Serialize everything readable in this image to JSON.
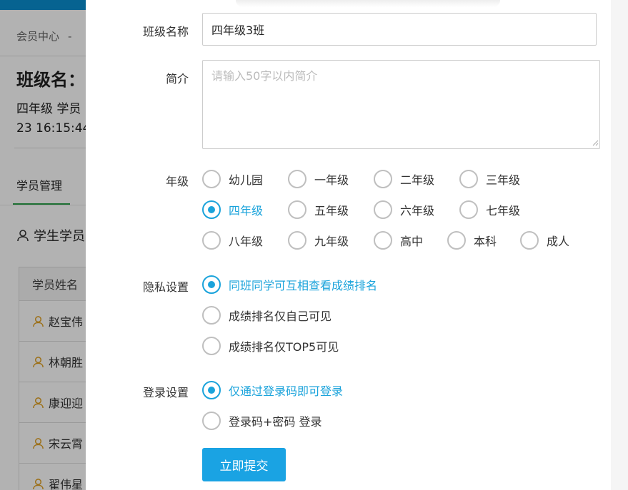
{
  "background": {
    "breadcrumb": "会员中心",
    "breadcrumb_sep": "-",
    "title": "班级名：",
    "info_line1": "四年级 学员",
    "info_line2": "23 16:15:44",
    "tab": "学员管理",
    "section": "学生学员",
    "table_header": "学员姓名",
    "rows": [
      "赵宝伟",
      "林朝胜",
      "康迎迎",
      "宋云霄",
      "翟伟星"
    ]
  },
  "form": {
    "name_label": "班级名称",
    "name_value": "四年级3班",
    "intro_label": "简介",
    "intro_placeholder": "请输入50字以内简介",
    "grade_label": "年级",
    "grades": [
      "幼儿园",
      "一年级",
      "二年级",
      "三年级",
      "四年级",
      "五年级",
      "六年级",
      "七年级",
      "八年级",
      "九年级",
      "高中",
      "本科",
      "成人"
    ],
    "grade_selected": "四年级",
    "privacy_label": "隐私设置",
    "privacy_options": [
      "同班同学可互相查看成绩排名",
      "成绩排名仅自己可见",
      "成绩排名仅TOP5可见"
    ],
    "privacy_selected": "同班同学可互相查看成绩排名",
    "login_label": "登录设置",
    "login_options": [
      "仅通过登录码即可登录",
      "登录码+密码 登录"
    ],
    "login_selected": "仅通过登录码即可登录",
    "submit_label": "立即提交"
  },
  "colors": {
    "accent": "#1aa3db",
    "button": "#1aa3e3",
    "tab_underline": "#2aa04a",
    "user_icon": "#e0a020"
  }
}
